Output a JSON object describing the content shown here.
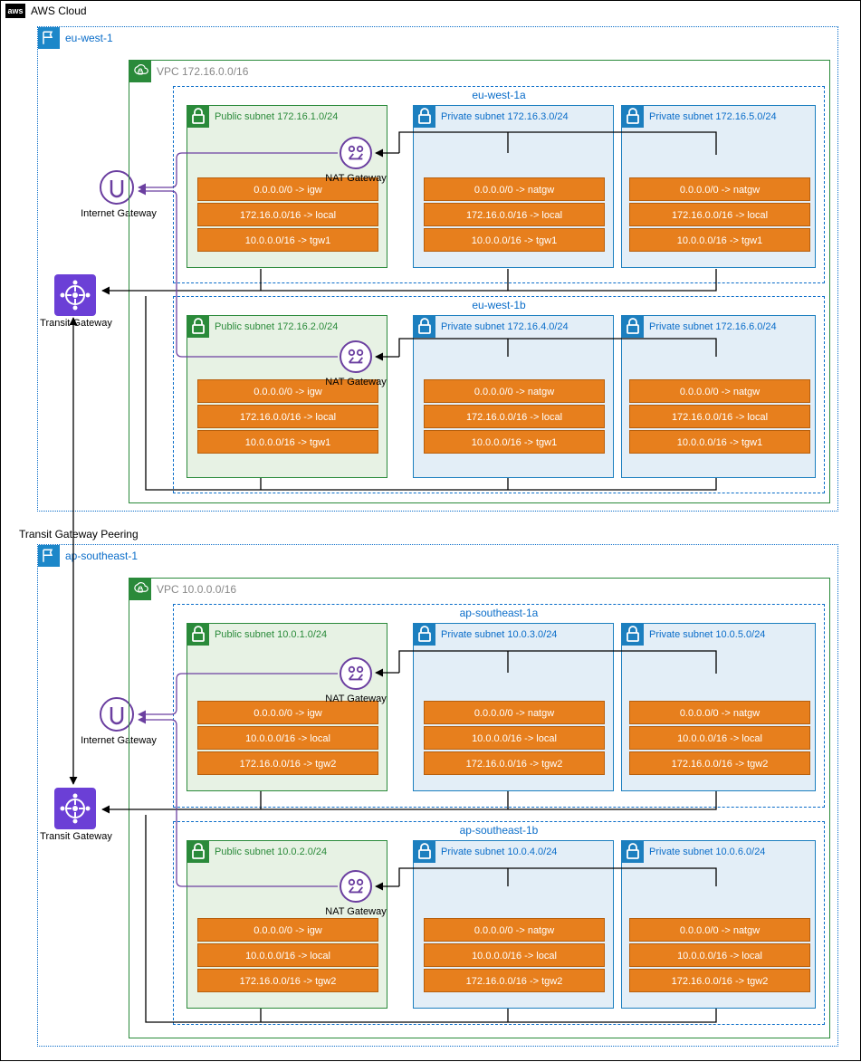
{
  "cloud": {
    "title": "AWS Cloud",
    "aws": "aws"
  },
  "peering_label": "Transit Gateway Peering",
  "regions": [
    {
      "id": "eu-west-1",
      "name": "eu-west-1",
      "vpc": {
        "label": "VPC 172.16.0.0/16"
      },
      "igw": "Internet Gateway",
      "tgw": "Transit Gateway",
      "nat_label": "NAT Gateway",
      "azs": [
        {
          "name": "eu-west-1a",
          "subnets": [
            {
              "kind": "public",
              "title": "Public subnet 172.16.1.0/24",
              "routes": [
                "0.0.0.0/0 -> igw",
                "172.16.0.0/16 -> local",
                "10.0.0.0/16 -> tgw1"
              ]
            },
            {
              "kind": "private",
              "title": "Private subnet 172.16.3.0/24",
              "routes": [
                "0.0.0.0/0 -> natgw",
                "172.16.0.0/16 -> local",
                "10.0.0.0/16 -> tgw1"
              ]
            },
            {
              "kind": "private",
              "title": "Private subnet 172.16.5.0/24",
              "routes": [
                "0.0.0.0/0 -> natgw",
                "172.16.0.0/16 -> local",
                "10.0.0.0/16 -> tgw1"
              ]
            }
          ]
        },
        {
          "name": "eu-west-1b",
          "subnets": [
            {
              "kind": "public",
              "title": "Public subnet 172.16.2.0/24",
              "routes": [
                "0.0.0.0/0 -> igw",
                "172.16.0.0/16 -> local",
                "10.0.0.0/16 -> tgw1"
              ]
            },
            {
              "kind": "private",
              "title": "Private subnet 172.16.4.0/24",
              "routes": [
                "0.0.0.0/0 -> natgw",
                "172.16.0.0/16 -> local",
                "10.0.0.0/16 -> tgw1"
              ]
            },
            {
              "kind": "private",
              "title": "Private subnet 172.16.6.0/24",
              "routes": [
                "0.0.0.0/0 -> natgw",
                "172.16.0.0/16 -> local",
                "10.0.0.0/16 -> tgw1"
              ]
            }
          ]
        }
      ]
    },
    {
      "id": "ap-southeast-1",
      "name": "ap-southeast-1",
      "vpc": {
        "label": "VPC 10.0.0.0/16"
      },
      "igw": "Internet Gateway",
      "tgw": "Transit Gateway",
      "nat_label": "NAT Gateway",
      "azs": [
        {
          "name": "ap-southeast-1a",
          "subnets": [
            {
              "kind": "public",
              "title": "Public subnet 10.0.1.0/24",
              "routes": [
                "0.0.0.0/0 -> igw",
                "10.0.0.0/16 -> local",
                "172.16.0.0/16 -> tgw2"
              ]
            },
            {
              "kind": "private",
              "title": "Private subnet 10.0.3.0/24",
              "routes": [
                "0.0.0.0/0 -> natgw",
                "10.0.0.0/16 -> local",
                "172.16.0.0/16 -> tgw2"
              ]
            },
            {
              "kind": "private",
              "title": "Private subnet 10.0.5.0/24",
              "routes": [
                "0.0.0.0/0 -> natgw",
                "10.0.0.0/16 -> local",
                "172.16.0.0/16 -> tgw2"
              ]
            }
          ]
        },
        {
          "name": "ap-southeast-1b",
          "subnets": [
            {
              "kind": "public",
              "title": "Public subnet 10.0.2.0/24",
              "routes": [
                "0.0.0.0/0 -> igw",
                "10.0.0.0/16 -> local",
                "172.16.0.0/16 -> tgw2"
              ]
            },
            {
              "kind": "private",
              "title": "Private subnet 10.0.4.0/24",
              "routes": [
                "0.0.0.0/0 -> natgw",
                "10.0.0.0/16 -> local",
                "172.16.0.0/16 -> tgw2"
              ]
            },
            {
              "kind": "private",
              "title": "Private subnet 10.0.6.0/24",
              "routes": [
                "0.0.0.0/0 -> natgw",
                "10.0.0.0/16 -> local",
                "172.16.0.0/16 -> tgw2"
              ]
            }
          ]
        }
      ]
    }
  ],
  "chart_data": {
    "type": "diagram",
    "title": "AWS multi-region VPC with Transit Gateway peering",
    "regions": [
      {
        "name": "eu-west-1",
        "vpc_cidr": "172.16.0.0/16",
        "availability_zones": [
          "eu-west-1a",
          "eu-west-1b"
        ],
        "public_subnets": [
          "172.16.1.0/24",
          "172.16.2.0/24"
        ],
        "private_subnets": [
          "172.16.3.0/24",
          "172.16.5.0/24",
          "172.16.4.0/24",
          "172.16.6.0/24"
        ],
        "default_route_public": "igw",
        "default_route_private": "natgw",
        "foreign_cidr_route": {
          "cidr": "10.0.0.0/16",
          "target": "tgw1"
        }
      },
      {
        "name": "ap-southeast-1",
        "vpc_cidr": "10.0.0.0/16",
        "availability_zones": [
          "ap-southeast-1a",
          "ap-southeast-1b"
        ],
        "public_subnets": [
          "10.0.1.0/24",
          "10.0.2.0/24"
        ],
        "private_subnets": [
          "10.0.3.0/24",
          "10.0.5.0/24",
          "10.0.4.0/24",
          "10.0.6.0/24"
        ],
        "default_route_public": "igw",
        "default_route_private": "natgw",
        "foreign_cidr_route": {
          "cidr": "172.16.0.0/16",
          "target": "tgw2"
        }
      }
    ],
    "inter_region_link": "Transit Gateway Peering"
  }
}
